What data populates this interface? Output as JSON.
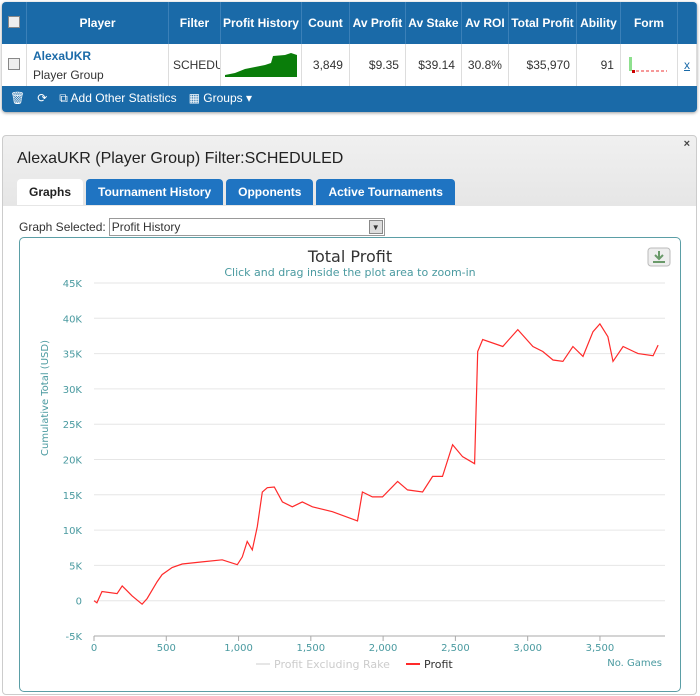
{
  "table": {
    "headers": [
      "Player",
      "Filter",
      "Profit History",
      "Count",
      "Av Profit",
      "Av Stake",
      "Av ROI",
      "Total Profit",
      "Ability",
      "Form"
    ],
    "row": {
      "player": "AlexaUKR",
      "group": "Player Group",
      "filter": "SCHEDULED",
      "count": "3,849",
      "av_profit": "$9.35",
      "av_stake": "$39.14",
      "av_roi": "30.8%",
      "total_profit": "$35,970",
      "ability": "91",
      "remove": "x"
    },
    "footer": {
      "add_stats": "Add Other Statistics",
      "groups": "Groups"
    }
  },
  "panel": {
    "title": "AlexaUKR (Player Group) Filter:SCHEDULED",
    "close": "×",
    "tabs": [
      {
        "label": "Graphs",
        "active": true
      },
      {
        "label": "Tournament History"
      },
      {
        "label": "Opponents"
      },
      {
        "label": "Active Tournaments"
      }
    ],
    "graph_label": "Graph Selected:",
    "graph_value": "Profit History"
  },
  "colors": {
    "header": "#1a6aa8",
    "tab": "#1f74c2",
    "profit": "#ff2a2a",
    "axis_text": "#4a9aa0"
  },
  "chart_data": {
    "type": "line",
    "title": "Total Profit",
    "subtitle": "Click and drag inside the plot area to zoom-in",
    "ylabel": "Cumulative Total (USD)",
    "xlabel": "No. Games",
    "ylim": [
      -5000,
      45000
    ],
    "xlim": [
      0,
      3950
    ],
    "yticks": [
      "-5K",
      "0",
      "5K",
      "10K",
      "15K",
      "20K",
      "25K",
      "30K",
      "35K",
      "40K",
      "45K"
    ],
    "xticks": [
      "0",
      "500",
      "1,000",
      "1,500",
      "2,000",
      "2,500",
      "3,000",
      "3,500"
    ],
    "grid": true,
    "legend": "bottom",
    "series": [
      {
        "name": "Profit Excluding Rake",
        "visible": false,
        "color": "#cccccc",
        "points": []
      },
      {
        "name": "Profit",
        "color": "#ff2a2a",
        "points": [
          [
            0,
            0
          ],
          [
            20,
            -300
          ],
          [
            55,
            1300
          ],
          [
            160,
            1000
          ],
          [
            195,
            2100
          ],
          [
            263,
            700
          ],
          [
            333,
            -500
          ],
          [
            367,
            300
          ],
          [
            437,
            2700
          ],
          [
            471,
            3700
          ],
          [
            540,
            4700
          ],
          [
            610,
            5200
          ],
          [
            748,
            5500
          ],
          [
            887,
            5800
          ],
          [
            991,
            5100
          ],
          [
            1026,
            6200
          ],
          [
            1060,
            8400
          ],
          [
            1095,
            7200
          ],
          [
            1130,
            10500
          ],
          [
            1164,
            15400
          ],
          [
            1199,
            16000
          ],
          [
            1247,
            16100
          ],
          [
            1303,
            14000
          ],
          [
            1372,
            13300
          ],
          [
            1441,
            14000
          ],
          [
            1511,
            13300
          ],
          [
            1649,
            12600
          ],
          [
            1823,
            11300
          ],
          [
            1857,
            15400
          ],
          [
            1926,
            14700
          ],
          [
            1996,
            14700
          ],
          [
            2100,
            16900
          ],
          [
            2169,
            15700
          ],
          [
            2273,
            15400
          ],
          [
            2342,
            17600
          ],
          [
            2411,
            17600
          ],
          [
            2481,
            22100
          ],
          [
            2550,
            20400
          ],
          [
            2633,
            19400
          ],
          [
            2654,
            35300
          ],
          [
            2689,
            37000
          ],
          [
            2828,
            36000
          ],
          [
            2932,
            38400
          ],
          [
            3036,
            36000
          ],
          [
            3105,
            35300
          ],
          [
            3175,
            34100
          ],
          [
            3244,
            33900
          ],
          [
            3313,
            36000
          ],
          [
            3383,
            34600
          ],
          [
            3452,
            38100
          ],
          [
            3500,
            39200
          ],
          [
            3555,
            37400
          ],
          [
            3590,
            33900
          ],
          [
            3660,
            36000
          ],
          [
            3764,
            35000
          ],
          [
            3868,
            34700
          ],
          [
            3902,
            36200
          ]
        ]
      }
    ]
  }
}
